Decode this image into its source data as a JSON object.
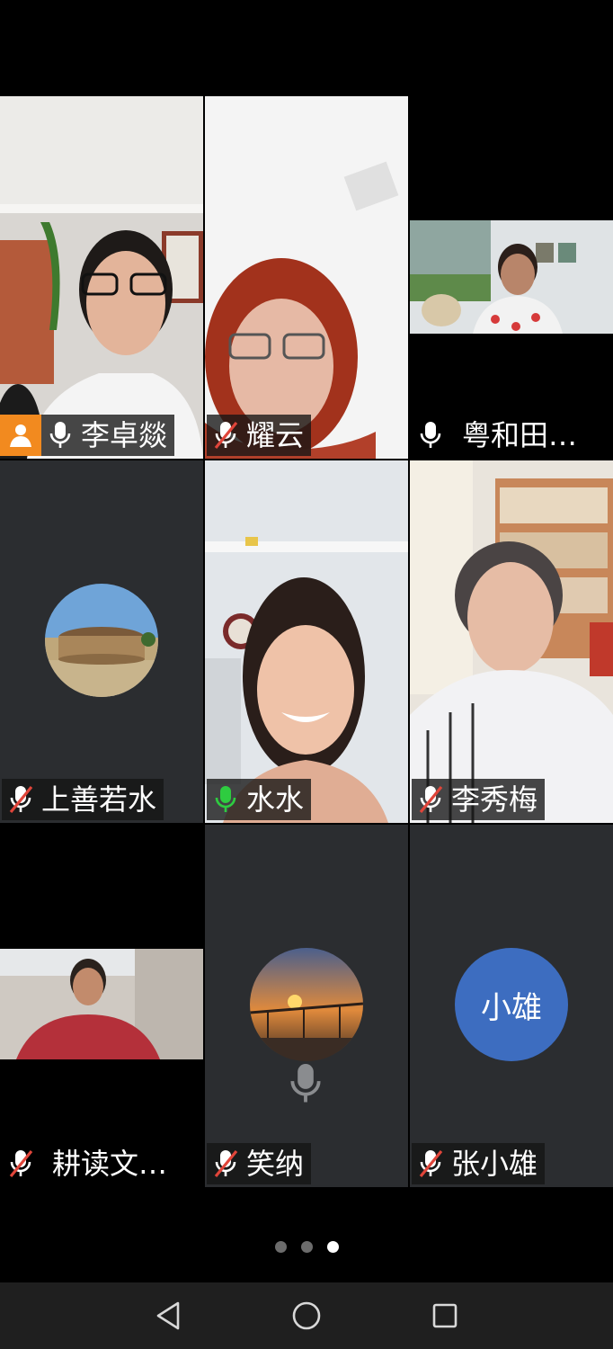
{
  "participants": [
    {
      "name": "李卓燚",
      "mic": "on",
      "host": true
    },
    {
      "name": "耀云",
      "mic": "muted"
    },
    {
      "name": "粤和田…",
      "mic": "on"
    },
    {
      "name": "上善若水",
      "mic": "muted"
    },
    {
      "name": "水水",
      "mic": "speaking"
    },
    {
      "name": "李秀梅",
      "mic": "muted"
    },
    {
      "name": "耕读文…",
      "mic": "muted"
    },
    {
      "name": "笑纳",
      "mic": "muted"
    },
    {
      "name": "张小雄",
      "mic": "muted",
      "avatar_text": "小雄"
    }
  ],
  "pager": {
    "pages": 3,
    "current": 3
  },
  "nav": {
    "back_icon": "triangle-back-icon",
    "home_icon": "circle-home-icon",
    "recents_icon": "square-recents-icon"
  },
  "colors": {
    "host_badge": "#f28a1f",
    "speaking_border": "#3cb371",
    "text_avatar_bg": "#3d6dc0",
    "muted_slash": "#e0453a"
  }
}
